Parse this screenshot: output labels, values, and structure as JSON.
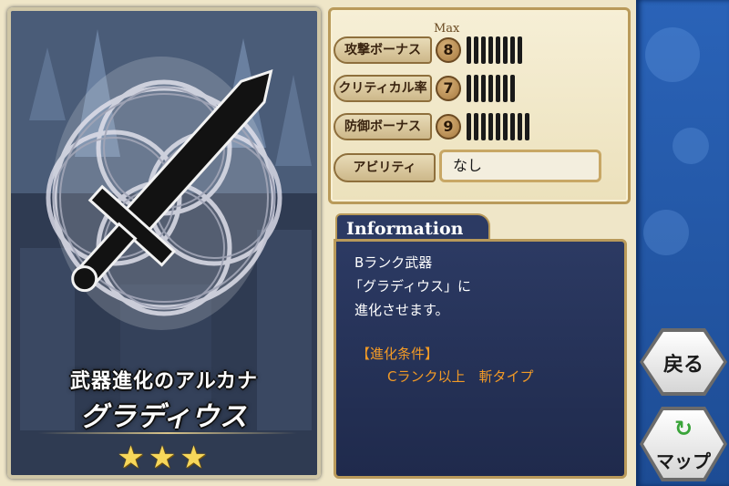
{
  "card": {
    "subtitle": "武器進化のアルカナ",
    "name": "グラディウス",
    "stars": "★★★",
    "rarity_stars": 3
  },
  "stats": {
    "max_label": "Max",
    "items": [
      {
        "label": "攻撃ボーナス",
        "value": "8",
        "level": 8
      },
      {
        "label": "クリティカル率",
        "value": "7",
        "level": 7
      },
      {
        "label": "防御ボーナス",
        "value": "9",
        "level": 9
      }
    ],
    "ability_label": "アビリティ",
    "ability_value": "なし"
  },
  "info": {
    "tab_label": "Information",
    "lines": [
      "Bランク武器",
      "「グラディウス」に",
      "進化させます。"
    ],
    "condition_title": "【進化条件】",
    "condition_text": "Cランク以上　斬タイプ"
  },
  "buttons": {
    "back_label": "戻る",
    "map_label": "マップ"
  },
  "colors": {
    "info_bg": "#2c3a63",
    "condition_accent": "#f29a26",
    "side_strip": "#2a63b8",
    "star": "#f7d75a"
  }
}
